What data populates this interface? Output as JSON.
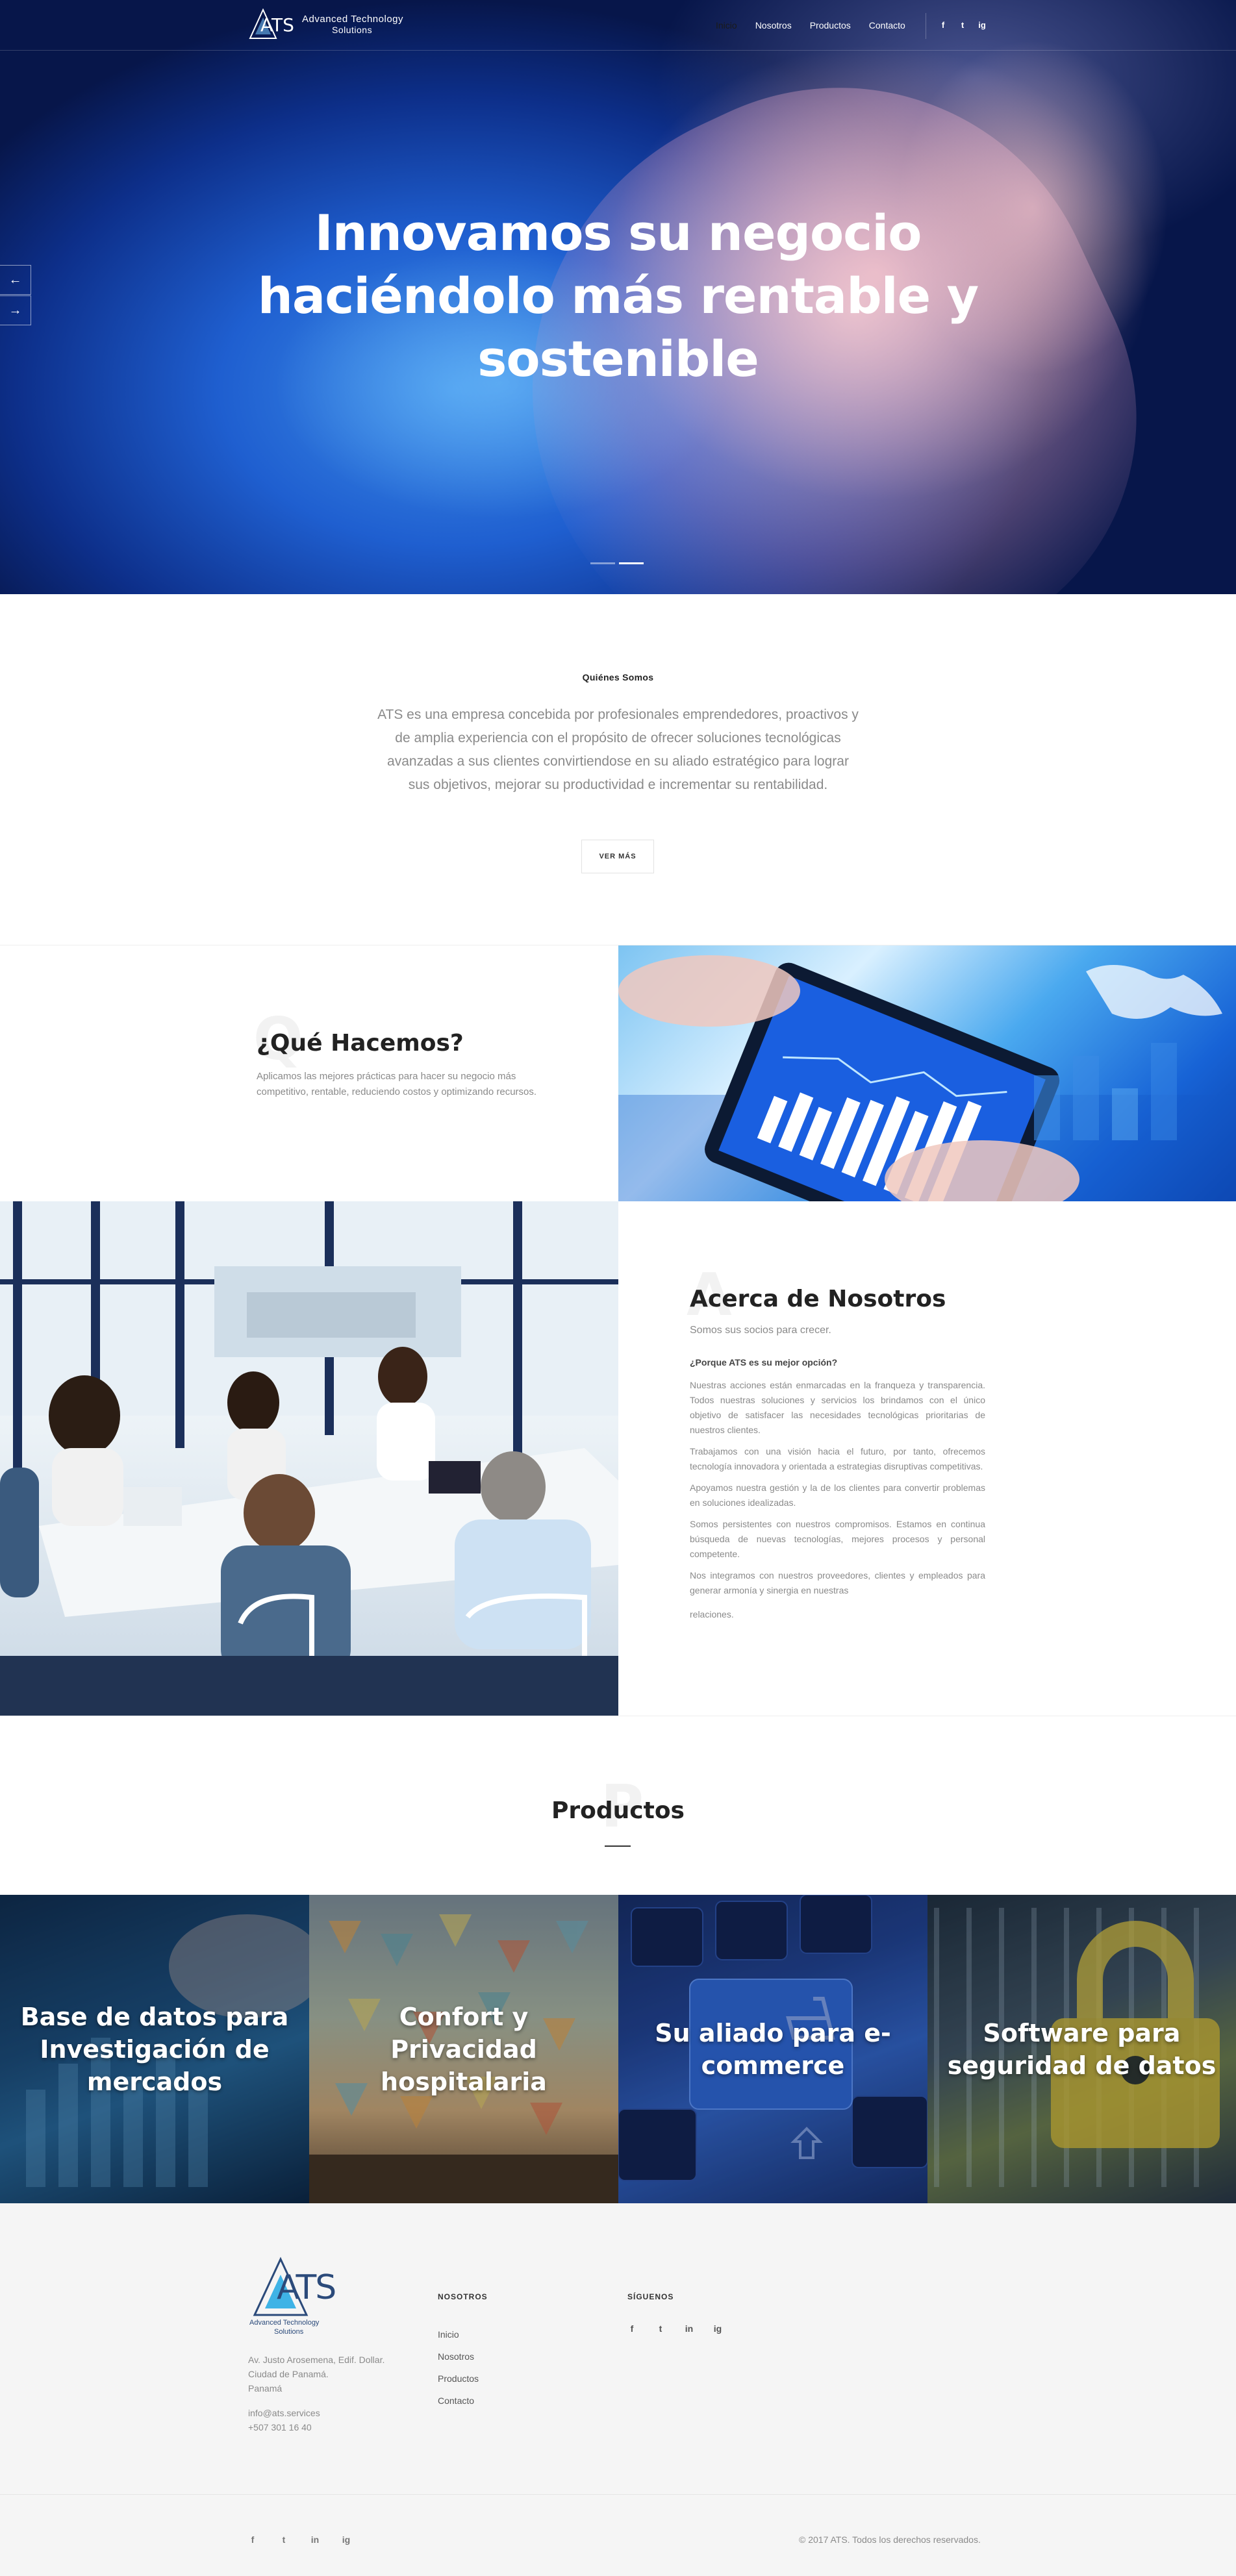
{
  "header": {
    "logo_letters": "ATS",
    "logo_line1": "Advanced Technology",
    "logo_line2": "Solutions",
    "nav": [
      "Inicio",
      "Nosotros",
      "Productos",
      "Contacto"
    ],
    "social": [
      "f",
      "t",
      "ig"
    ]
  },
  "hero": {
    "title_lines": [
      "Innovamos su negocio",
      "haciéndolo más rentable y",
      "sostenible"
    ],
    "prev": "←",
    "next": "→"
  },
  "about": {
    "title": "Quiénes Somos",
    "text": "ATS es una empresa concebida por profesionales emprendedores, proactivos y de amplia experiencia con el propósito de ofrecer soluciones tecnológicas avanzadas a sus clientes convirtiendose en su aliado estratégico para lograr sus objetivos, mejorar su productividad e incrementar su rentabilidad.",
    "button": "VER MÁS"
  },
  "hacemos": {
    "ghost": "Q",
    "title": "¿Qué Hacemos?",
    "text": "Aplicamos las mejores prácticas para hacer su negocio más competitivo, rentable, reduciendo costos y optimizando recursos."
  },
  "acerca": {
    "ghost": "A",
    "title": "Acerca de Nosotros",
    "subtitle": "Somos sus socios para crecer.",
    "question": "¿Porque ATS es su mejor opción?",
    "paragraphs": [
      "Nuestras acciones están enmarcadas en la franqueza y transparencia. Todos nuestras soluciones y servicios los brindamos con el único objetivo de satisfacer las necesidades tecnológicas prioritarias de nuestros clientes.",
      "Trabajamos con una visión hacia el futuro, por tanto, ofrecemos tecnología innovadora y orientada a estrategias disruptivas competitivas.",
      "Apoyamos nuestra gestión y la de los clientes para convertir problemas en soluciones idealizadas.",
      "Somos persistentes con nuestros compromisos. Estamos en continua búsqueda de nuevas tecnologías, mejores procesos y personal competente.",
      "Nos integramos con nuestros proveedores, clientes y empleados para generar armonía y sinergia en nuestras",
      "relaciones."
    ]
  },
  "productos": {
    "ghost": "P",
    "title": "Productos",
    "items": [
      "Base de datos para Investigación de mercados",
      "Confort y Privacidad hospitalaria",
      "Su aliado para e-commerce",
      "Software para seguridad de datos"
    ]
  },
  "footer": {
    "address_lines": [
      "Av. Justo Arosemena, Edif. Dollar.",
      "Ciudad de Panamá.",
      "Panamá"
    ],
    "email": "info@ats.services",
    "phone": "+507 301 16 40",
    "nav_title": "NOSOTROS",
    "nav_items": [
      "Inicio",
      "Nosotros",
      "Productos",
      "Contacto"
    ],
    "follow_title": "SÍGUENOS",
    "social": [
      "f",
      "t",
      "in",
      "ig"
    ],
    "copyright": "© 2017 ATS. Todos los derechos reservados."
  },
  "colors": {
    "accent": "#1f5fd0",
    "text_dark": "#222222",
    "text_muted": "#8a8a8a",
    "footer_bg": "#f5f5f5"
  }
}
